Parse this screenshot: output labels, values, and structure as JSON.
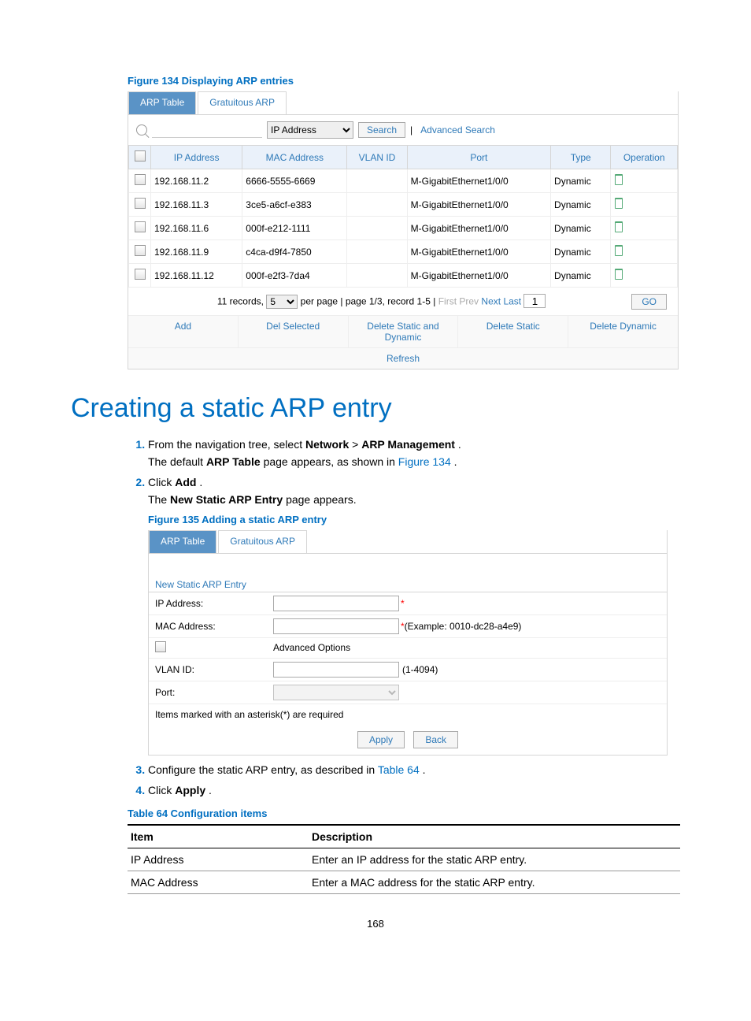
{
  "figure1_caption": "Figure 134 Displaying ARP entries",
  "tabs": {
    "arp_table": "ARP Table",
    "gratuitous": "Gratuitous ARP"
  },
  "search": {
    "field_option": "IP Address",
    "button": "Search",
    "advanced": "Advanced Search"
  },
  "columns": {
    "ip": "IP Address",
    "mac": "MAC Address",
    "vlan": "VLAN ID",
    "port": "Port",
    "type": "Type",
    "operation": "Operation"
  },
  "rows": [
    {
      "ip": "192.168.11.2",
      "mac": "6666-5555-6669",
      "vlan": "",
      "port": "M-GigabitEthernet1/0/0",
      "type": "Dynamic"
    },
    {
      "ip": "192.168.11.3",
      "mac": "3ce5-a6cf-e383",
      "vlan": "",
      "port": "M-GigabitEthernet1/0/0",
      "type": "Dynamic"
    },
    {
      "ip": "192.168.11.6",
      "mac": "000f-e212-1111",
      "vlan": "",
      "port": "M-GigabitEthernet1/0/0",
      "type": "Dynamic"
    },
    {
      "ip": "192.168.11.9",
      "mac": "c4ca-d9f4-7850",
      "vlan": "",
      "port": "M-GigabitEthernet1/0/0",
      "type": "Dynamic"
    },
    {
      "ip": "192.168.11.12",
      "mac": "000f-e2f3-7da4",
      "vlan": "",
      "port": "M-GigabitEthernet1/0/0",
      "type": "Dynamic"
    }
  ],
  "pager": {
    "records_prefix": "11 records,",
    "per_page_value": "5",
    "per_page_suffix": "per page | page 1/3, record 1-5 |",
    "first": "First",
    "prev": "Prev",
    "next": "Next",
    "last": "Last",
    "page_input": "1",
    "go": "GO"
  },
  "actions": {
    "add": "Add",
    "del_selected": "Del Selected",
    "del_sd": "Delete Static and Dynamic",
    "del_static": "Delete Static",
    "del_dynamic": "Delete Dynamic",
    "refresh": "Refresh"
  },
  "section_heading": "Creating a static ARP entry",
  "steps": {
    "s1a": "From the navigation tree, select ",
    "s1_network": "Network",
    "s1_gt": " > ",
    "s1_arp": "ARP Management",
    "s1_dot": ".",
    "s1b_pre": "The default ",
    "s1b_bold": "ARP Table",
    "s1b_mid": " page appears, as shown in ",
    "s1b_link": "Figure 134",
    "s1b_end": ".",
    "s2a_pre": "Click ",
    "s2a_bold": "Add",
    "s2a_end": " .",
    "s2b_pre": "The ",
    "s2b_bold": "New Static ARP Entry",
    "s2b_end": " page appears.",
    "fig135": "Figure 135 Adding a static ARP entry",
    "s3_pre": "Configure the static ARP entry, as described in ",
    "s3_link": "Table 64",
    "s3_end": ".",
    "s4_pre": "Click ",
    "s4_bold": "Apply",
    "s4_end": "."
  },
  "form": {
    "title": "New Static ARP Entry",
    "ip_label": "IP Address:",
    "mac_label": "MAC Address:",
    "mac_example": "(Example: 0010-dc28-a4e9)",
    "adv_options": "Advanced Options",
    "vlan_label": "VLAN ID:",
    "vlan_range": "(1-4094)",
    "port_label": "Port:",
    "footnote": "Items marked with an asterisk(*) are required",
    "apply": "Apply",
    "back": "Back"
  },
  "table_caption": "Table 64 Configuration items",
  "ci_headers": {
    "item": "Item",
    "desc": "Description"
  },
  "ci_rows": [
    {
      "item": "IP Address",
      "desc": "Enter an IP address for the static ARP entry."
    },
    {
      "item": "MAC Address",
      "desc": "Enter a MAC address for the static ARP entry."
    }
  ],
  "page_number": "168"
}
